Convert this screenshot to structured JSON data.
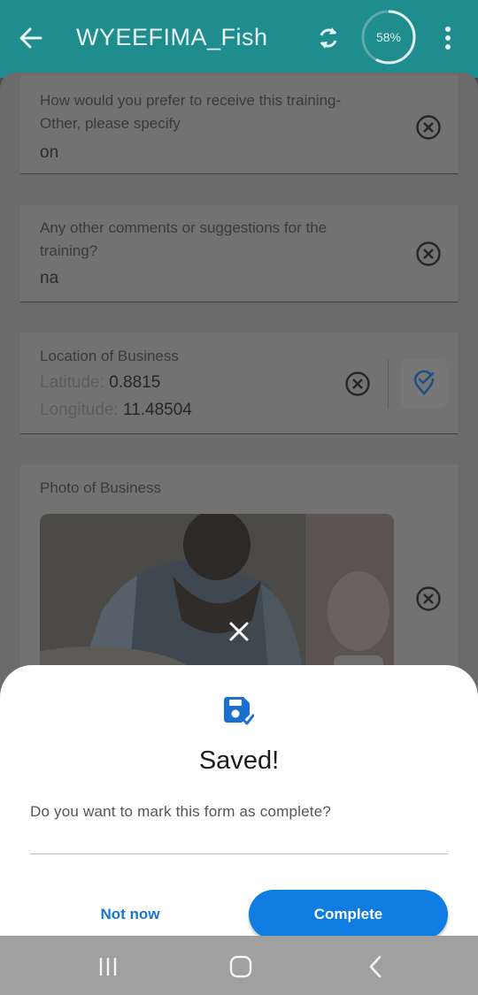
{
  "appbar": {
    "title": "WYEEFIMA_Fish",
    "progress_label": "58%",
    "progress_value": 0.58
  },
  "form": {
    "training_other": {
      "label": "How would you prefer to receive this training- Other, please specify",
      "value": "on"
    },
    "comments": {
      "label": "Any other comments or suggestions for the training?",
      "value": "na"
    },
    "location": {
      "label": "Location of Business",
      "latitude_label": "Latitude:",
      "latitude_value": "0.8815",
      "longitude_label": "Longitude:",
      "longitude_value": "11.48504"
    },
    "photo": {
      "label": "Photo of Business"
    }
  },
  "dialog": {
    "title": "Saved!",
    "message": "Do you want to mark this form as complete?",
    "secondary_button": "Not now",
    "primary_button": "Complete"
  },
  "colors": {
    "appbar": "#1f8c8e",
    "primary": "#0f7ce2",
    "link": "#1976d2"
  },
  "icons": {
    "back": "arrow-left-icon",
    "sync": "sync-icon",
    "more": "more-vert-icon",
    "clear": "clear-circle-icon",
    "pin": "location-pin-icon",
    "close": "close-icon",
    "save": "save-check-icon",
    "nav_recents": "recents-icon",
    "nav_home": "home-icon",
    "nav_back": "back-chevron-icon"
  }
}
